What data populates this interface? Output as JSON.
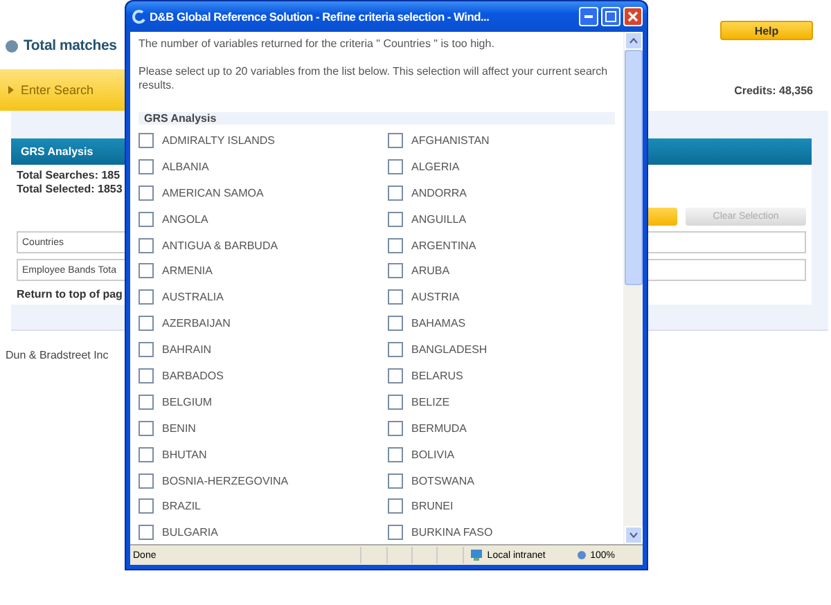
{
  "page": {
    "total_matches": "Total matches",
    "enter_search": "Enter Search",
    "help_button": "Help",
    "credits": "Credits: 48,356",
    "panel": {
      "title": "GRS Analysis",
      "total_searches": "Total Searches: 185",
      "total_selected": "Total Selected: 1853",
      "clear_selection": "Clear Selection",
      "fields": [
        "Countries",
        "Employee Bands Tota"
      ],
      "return_link": "Return to top of pag"
    },
    "footer": "Dun & Bradstreet Inc"
  },
  "popup": {
    "title": "D&B Global Reference Solution - Refine criteria selection - Wind...",
    "message": "The number of variables returned for the criteria \" Countries \" is too high.",
    "instructions": "Please select up to 20 variables from the list below. This selection will affect your current search results.",
    "section": "GRS Analysis",
    "options": [
      {
        "label": "ADMIRALTY ISLANDS",
        "checked": false
      },
      {
        "label": "AFGHANISTAN",
        "checked": false
      },
      {
        "label": "ALBANIA",
        "checked": false
      },
      {
        "label": "ALGERIA",
        "checked": false
      },
      {
        "label": "AMERICAN SAMOA",
        "checked": false
      },
      {
        "label": "ANDORRA",
        "checked": false
      },
      {
        "label": "ANGOLA",
        "checked": false
      },
      {
        "label": "ANGUILLA",
        "checked": false
      },
      {
        "label": "ANTIGUA & BARBUDA",
        "checked": false
      },
      {
        "label": "ARGENTINA",
        "checked": false
      },
      {
        "label": "ARMENIA",
        "checked": false
      },
      {
        "label": "ARUBA",
        "checked": false
      },
      {
        "label": "AUSTRALIA",
        "checked": false
      },
      {
        "label": "AUSTRIA",
        "checked": false
      },
      {
        "label": "AZERBAIJAN",
        "checked": false
      },
      {
        "label": "BAHAMAS",
        "checked": false
      },
      {
        "label": "BAHRAIN",
        "checked": false
      },
      {
        "label": "BANGLADESH",
        "checked": false
      },
      {
        "label": "BARBADOS",
        "checked": false
      },
      {
        "label": "BELARUS",
        "checked": false
      },
      {
        "label": "BELGIUM",
        "checked": false
      },
      {
        "label": "BELIZE",
        "checked": false
      },
      {
        "label": "BENIN",
        "checked": false
      },
      {
        "label": "BERMUDA",
        "checked": false
      },
      {
        "label": "BHUTAN",
        "checked": false
      },
      {
        "label": "BOLIVIA",
        "checked": false
      },
      {
        "label": "BOSNIA-HERZEGOVINA",
        "checked": false
      },
      {
        "label": "BOTSWANA",
        "checked": false
      },
      {
        "label": "BRAZIL",
        "checked": false
      },
      {
        "label": "BRUNEI",
        "checked": false
      },
      {
        "label": "BULGARIA",
        "checked": false
      },
      {
        "label": "BURKINA FASO",
        "checked": false
      }
    ],
    "status": {
      "text": "Done",
      "zone": "Local intranet",
      "zoom": "100%"
    }
  }
}
